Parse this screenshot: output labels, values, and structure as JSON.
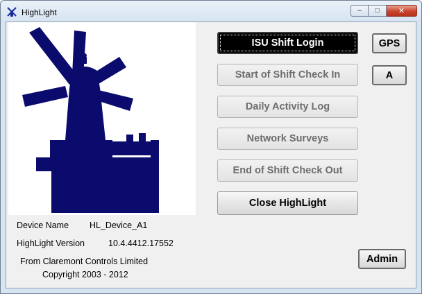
{
  "window": {
    "title": "HighLight"
  },
  "caption": {
    "minimize": "–",
    "maximize": "□",
    "close": "✕"
  },
  "info": {
    "device_label": "Device Name",
    "device_value": "HL_Device_A1",
    "version_label": "HighLight Version",
    "version_value": "10.4.4412.17552",
    "company": "From Claremont Controls Limited",
    "copyright": "Copyright 2003 - 2012"
  },
  "buttons": {
    "isu_login": "ISU Shift Login",
    "start_checkin": "Start of Shift Check In",
    "daily_log": "Daily Activity Log",
    "network_surveys": "Network Surveys",
    "end_checkout": "End of Shift Check Out",
    "close_app": "Close HighLight",
    "gps": "GPS",
    "a": "A",
    "admin": "Admin"
  },
  "colors": {
    "logo": "#0b0b6e"
  },
  "icons": {
    "app": "windmill-icon",
    "logo": "windmill-logo"
  }
}
